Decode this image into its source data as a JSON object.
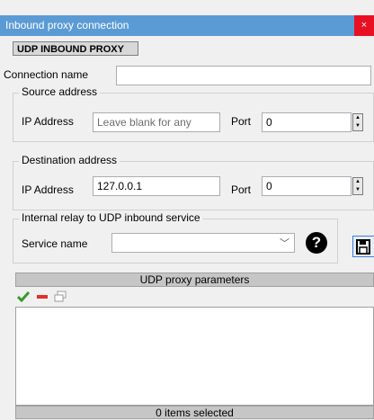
{
  "window": {
    "title": "Inbound proxy connection",
    "close_glyph": "×"
  },
  "badge": "UDP INBOUND PROXY",
  "connection_name": {
    "label": "Connection name",
    "value": ""
  },
  "source": {
    "title": "Source address",
    "ip_label": "IP Address",
    "ip_placeholder": "Leave blank for any",
    "port_label": "Port",
    "port_value": "0"
  },
  "destination": {
    "title": "Destination address",
    "ip_label": "IP Address",
    "ip_value": "127.0.0.1",
    "port_label": "Port",
    "port_value": "0"
  },
  "relay": {
    "title": "Internal relay to UDP inbound service",
    "service_label": "Service name",
    "service_value": "",
    "help_glyph": "?"
  },
  "params": {
    "header": "UDP proxy parameters",
    "toolbar": {
      "add_icon": "checkmark-icon",
      "remove_icon": "minus-icon",
      "window_icon": "window-icon"
    },
    "status": "0 items selected"
  },
  "colors": {
    "titlebar": "#5b9bd5",
    "close": "#e81123"
  }
}
